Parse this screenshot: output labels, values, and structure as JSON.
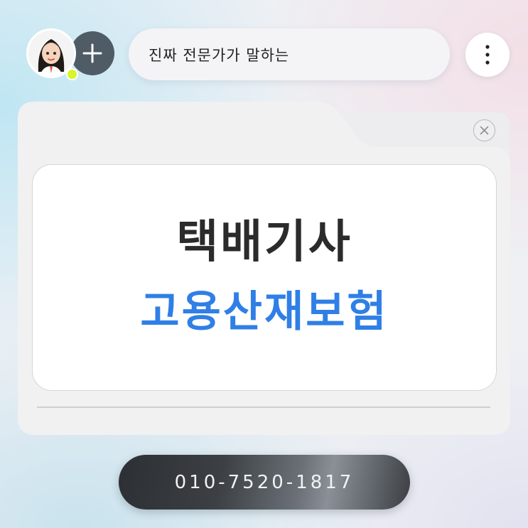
{
  "header": {
    "search_text": "진짜 전문가가 말하는",
    "add_icon": "plus-icon",
    "menu_icon": "more-vertical-icon",
    "avatar_icon": "user-avatar",
    "status_color": "#d8f52a"
  },
  "folder": {
    "close_icon": "close-icon",
    "title_line_1": "택배기사",
    "title_line_2": "고용산재보험",
    "title_line_1_color": "#2b2b2b",
    "title_line_2_color": "#2f7fe6"
  },
  "footer": {
    "phone": "010-7520-1817"
  }
}
